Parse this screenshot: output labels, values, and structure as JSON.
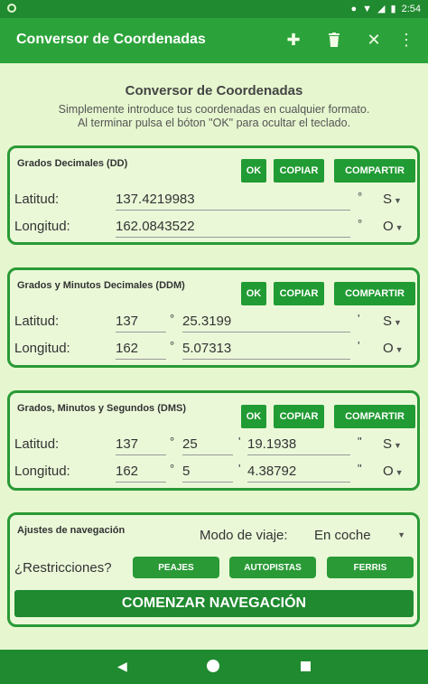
{
  "status": {
    "time": "2:54"
  },
  "appbar": {
    "title": "Conversor de Coordenadas"
  },
  "intro": {
    "heading": "Conversor de Coordenadas",
    "line1": "Simplemente introduce tus coordenadas en cualquier formato.",
    "line2": "Al terminar pulsa el bóton \"OK\" para ocultar el teclado."
  },
  "buttons": {
    "ok": "OK",
    "copy": "COPIAR",
    "share": "COMPARTIR"
  },
  "dd": {
    "title": "Grados Decimales (DD)",
    "lat_label": "Latitud:",
    "lat_value": "137.4219983",
    "lat_dir": "S",
    "lon_label": "Longitud:",
    "lon_value": "162.0843522",
    "lon_dir": "O"
  },
  "ddm": {
    "title": "Grados y Minutos Decimales (DDM)",
    "lat_label": "Latitud:",
    "lat_deg": "137",
    "lat_min": "25.3199",
    "lat_dir": "S",
    "lon_label": "Longitud:",
    "lon_deg": "162",
    "lon_min": "5.07313",
    "lon_dir": "O"
  },
  "dms": {
    "title": "Grados, Minutos y Segundos (DMS)",
    "lat_label": "Latitud:",
    "lat_deg": "137",
    "lat_min": "25",
    "lat_sec": "19.1938",
    "lat_dir": "S",
    "lon_label": "Longitud:",
    "lon_deg": "162",
    "lon_min": "5",
    "lon_sec": "4.38792",
    "lon_dir": "O"
  },
  "nav": {
    "title": "Ajustes de navegación",
    "mode_label": "Modo de viaje:",
    "mode_value": "En coche",
    "restrictions_label": "¿Restricciones?",
    "tolls": "PEAJES",
    "highways": "AUTOPISTAS",
    "ferries": "FERRIS",
    "start": "COMENZAR NAVEGACIÓN"
  },
  "symbols": {
    "degree": "°",
    "minute": "'",
    "second": "\""
  }
}
